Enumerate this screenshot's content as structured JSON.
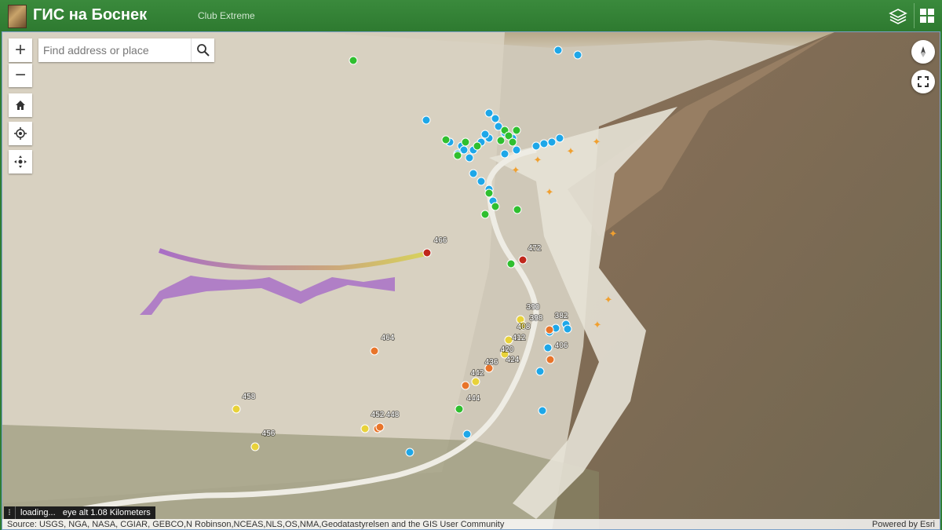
{
  "header": {
    "title": "ГИС на Боснек",
    "subtitle": "Club Extreme",
    "logo_icon": "photo-thumbnail-icon",
    "layers_icon": "layers-icon",
    "apps_icon": "grid-icon"
  },
  "search": {
    "placeholder": "Find address or place",
    "value": ""
  },
  "controls": {
    "zoom_in": "+",
    "zoom_out": "−",
    "home_icon": "home-icon",
    "locate_icon": "locate-icon",
    "navigate_icon": "navigation-toggle-icon",
    "compass_icon": "compass-icon",
    "fullscreen_icon": "fullscreen-icon"
  },
  "status": {
    "loading": "loading...",
    "eye_alt": "eye alt 1.08 Kilometers"
  },
  "attribution": {
    "source": "Source: USGS, NGA, NASA, CGIAR, GEBCO,N Robinson,NCEAS,NLS,OS,NMA,Geodatastyrelsen and the GIS User Community",
    "powered": "Powered by Esri"
  },
  "point_labels": [
    "466",
    "472",
    "390",
    "398",
    "382",
    "408",
    "412",
    "406",
    "420",
    "424",
    "436",
    "442",
    "444",
    "464",
    "458",
    "452",
    "448",
    "456"
  ],
  "colors": {
    "header": "#2e7a30",
    "blue_points": "#1ea7e8",
    "green_points": "#2fbf2f",
    "orange_points": "#e8742a",
    "yellow_points": "#e8d23a",
    "red_points": "#c0281c",
    "track": "#a05cc8"
  }
}
